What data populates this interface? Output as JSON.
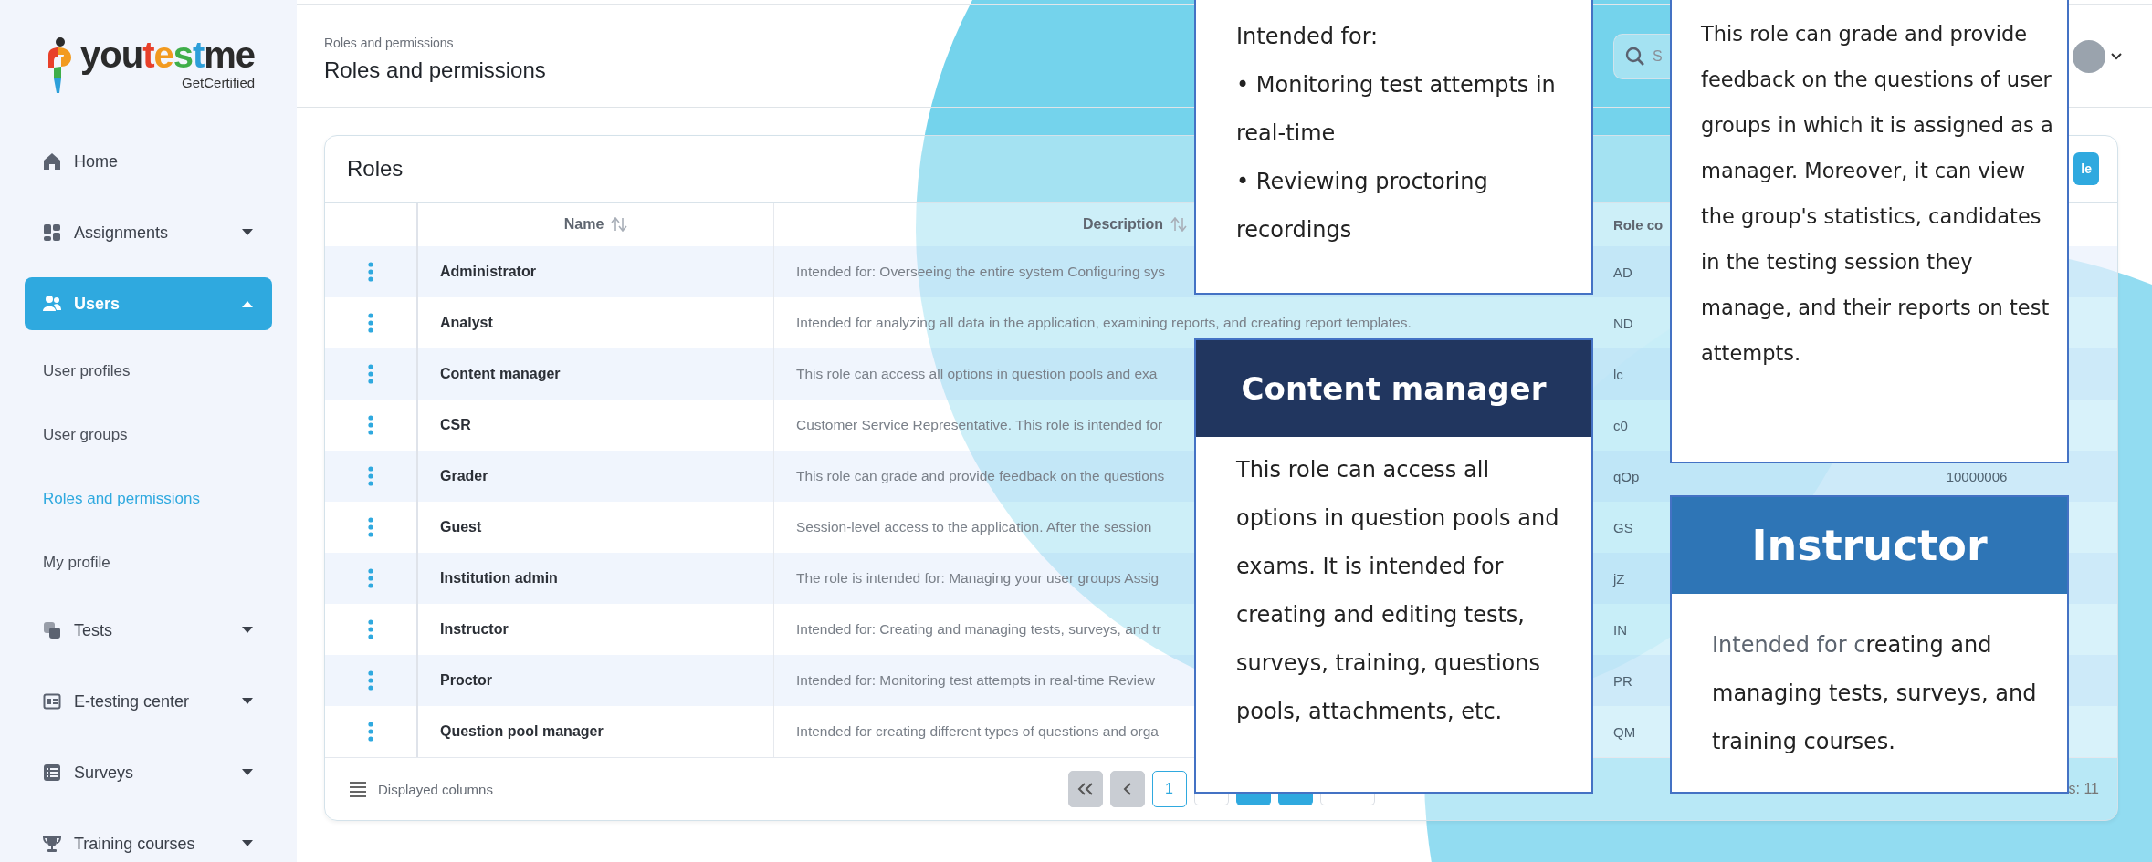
{
  "logo": {
    "parts": [
      {
        "text": "you",
        "color": "#2b2b2b"
      },
      {
        "text": "t",
        "color": "#e8402a"
      },
      {
        "text": "e",
        "color": "#f29a1f"
      },
      {
        "text": "s",
        "color": "#3fae49"
      },
      {
        "text": "t",
        "color": "#2d9fd9"
      },
      {
        "text": "me",
        "color": "#2b2b2b"
      }
    ],
    "tagline": "GetCertified"
  },
  "nav": [
    {
      "label": "Home",
      "kind": "link",
      "selected": false
    },
    {
      "label": "Assignments",
      "kind": "group",
      "expanded": false,
      "selected": false
    },
    {
      "label": "Users",
      "kind": "group",
      "expanded": true,
      "selected": true,
      "children": [
        {
          "label": "User profiles",
          "selected": false
        },
        {
          "label": "User groups",
          "selected": false
        },
        {
          "label": "Roles and permissions",
          "selected": true
        },
        {
          "label": "My profile",
          "selected": false
        }
      ]
    },
    {
      "label": "Tests",
      "kind": "group",
      "expanded": false,
      "selected": false
    },
    {
      "label": "E-testing center",
      "kind": "group",
      "expanded": false,
      "selected": false
    },
    {
      "label": "Surveys",
      "kind": "group",
      "expanded": false,
      "selected": false
    },
    {
      "label": "Training courses",
      "kind": "group",
      "expanded": false,
      "selected": false
    }
  ],
  "header": {
    "breadcrumb": "Roles and permissions",
    "title": "Roles and permissions",
    "search": {
      "placeholder": "S"
    }
  },
  "table": {
    "title": "Roles",
    "add_button": "le",
    "columns": [
      {
        "label": "Name",
        "sortable": true
      },
      {
        "label": "Description",
        "sortable": true
      },
      {
        "label": "Role co",
        "sortable": false
      }
    ],
    "rows": [
      {
        "name": "Administrator",
        "description": "Intended for: Overseeing the entire system Configuring sys",
        "role_code": "AD"
      },
      {
        "name": "Analyst",
        "description": "Intended for analyzing all data in the application, examining reports, and creating report templates.",
        "role_code": "ND"
      },
      {
        "name": "Content manager",
        "description": "This role can access all options in question pools and exa",
        "role_code": "lc"
      },
      {
        "name": "CSR",
        "description": "Customer Service Representative. This role is intended for",
        "role_code": "c0"
      },
      {
        "name": "Grader",
        "description": "This role can grade and provide feedback on the questions",
        "role_code": "qOp",
        "column_5": "10000006"
      },
      {
        "name": "Guest",
        "description": "Session-level access to the application. After the session",
        "role_code": "GS"
      },
      {
        "name": "Institution admin",
        "description": "The role is intended for: Managing your user groups Assig",
        "role_code": "jZ"
      },
      {
        "name": "Instructor",
        "description": "Intended for: Creating and managing tests, surveys, and tr",
        "role_code": "IN"
      },
      {
        "name": "Proctor",
        "description": "Intended for: Monitoring test attempts in real-time Review",
        "role_code": "PR"
      },
      {
        "name": "Question pool manager",
        "description": "Intended for creating different types of questions and orga",
        "role_code": "QM"
      }
    ],
    "footer": {
      "displayed_columns": "Displayed columns",
      "pagination": [
        {
          "kind": "first"
        },
        {
          "kind": "previous"
        },
        {
          "kind": "page",
          "label": "1",
          "selected": true
        },
        {
          "kind": "covered",
          "filled": false
        },
        {
          "kind": "covered",
          "filled": true
        },
        {
          "kind": "covered",
          "filled": true
        },
        {
          "kind": "covered",
          "filled": false
        }
      ],
      "total": "s: 11"
    }
  },
  "callouts": [
    {
      "kind": "lines",
      "lines": [
        "Intended for:",
        "• Monitoring test attempts in real-time",
        "• Reviewing proctoring recordings"
      ]
    },
    {
      "kind": "paragraph",
      "title": "Content manager",
      "color": "#21365f",
      "text": "This role can access all options in question pools and exams. It is intended for creating and editing tests, surveys, training, questions pools, attachments, etc."
    },
    {
      "kind": "paragraph",
      "text": "This role can grade and provide feedback on the questions of user groups in which it is assigned as a manager. Moreover, it can view the group's statistics, candidates in the testing session they manage, and their reports on test attempts."
    },
    {
      "kind": "parts",
      "title": "Instructor",
      "color": "#2e75b6",
      "parts": [
        {
          "text": "Intended for c",
          "muted": true
        },
        {
          "text": "reating and managing tests, surveys, and training courses.",
          "muted": false
        }
      ]
    }
  ]
}
